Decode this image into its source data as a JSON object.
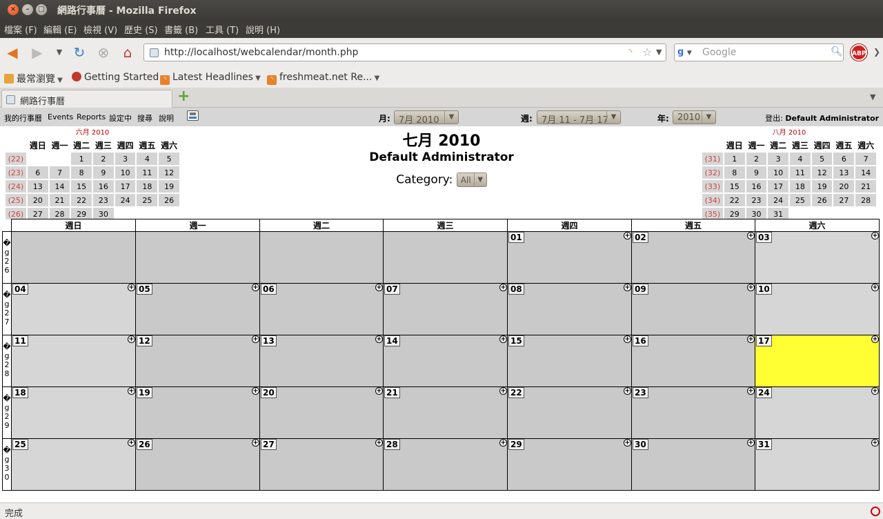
{
  "window": {
    "title": "網路行事曆 - Mozilla Firefox"
  },
  "menu": [
    "檔案 (F)",
    "編輯 (E)",
    "檢視 (V)",
    "歷史 (S)",
    "書籤 (B)",
    "工具 (T)",
    "說明 (H)"
  ],
  "nav": {
    "url": "http://localhost/webcalendar/month.php",
    "search_placeholder": "Google",
    "search_engine": "g",
    "abp_label": "ABP"
  },
  "bookmarks": [
    "最常瀏覽",
    "Getting Started",
    "Latest Headlines",
    "freshmeat.net Re..."
  ],
  "tab": {
    "title": "網路行事曆"
  },
  "app": {
    "links": [
      "我的行事曆",
      "Events",
      "Reports",
      "設定中",
      "搜尋",
      "說明"
    ],
    "month_label": "月:",
    "month_value": "7月 2010",
    "week_label": "週:",
    "week_value": "7月 11 - 7月 17",
    "year_label": "年:",
    "year_value": "2010",
    "logout_label": "登出:",
    "logout_user": "Default Administrator"
  },
  "header": {
    "month_title": "七月 2010",
    "user": "Default Administrator",
    "category_label": "Category:",
    "category_value": "All"
  },
  "weekday_short": [
    "週日",
    "週一",
    "週二",
    "週三",
    "週四",
    "週五",
    "週六"
  ],
  "mini_prev": {
    "title": "六月 2010",
    "weeks": [
      {
        "wk": "(22)",
        "days": [
          "",
          "",
          "1",
          "2",
          "3",
          "4",
          "5"
        ]
      },
      {
        "wk": "(23)",
        "days": [
          "6",
          "7",
          "8",
          "9",
          "10",
          "11",
          "12"
        ]
      },
      {
        "wk": "(24)",
        "days": [
          "13",
          "14",
          "15",
          "16",
          "17",
          "18",
          "19"
        ]
      },
      {
        "wk": "(25)",
        "days": [
          "20",
          "21",
          "22",
          "23",
          "24",
          "25",
          "26"
        ]
      },
      {
        "wk": "(26)",
        "days": [
          "27",
          "28",
          "29",
          "30",
          "",
          "",
          ""
        ]
      }
    ]
  },
  "mini_next": {
    "title": "八月 2010",
    "weeks": [
      {
        "wk": "(31)",
        "days": [
          "1",
          "2",
          "3",
          "4",
          "5",
          "6",
          "7"
        ]
      },
      {
        "wk": "(32)",
        "days": [
          "8",
          "9",
          "10",
          "11",
          "12",
          "13",
          "14"
        ]
      },
      {
        "wk": "(33)",
        "days": [
          "15",
          "16",
          "17",
          "18",
          "19",
          "20",
          "21"
        ]
      },
      {
        "wk": "(34)",
        "days": [
          "22",
          "23",
          "24",
          "25",
          "26",
          "27",
          "28"
        ]
      },
      {
        "wk": "(35)",
        "days": [
          "29",
          "30",
          "31",
          "",
          "",
          "",
          ""
        ]
      }
    ]
  },
  "month_grid": {
    "today": "17",
    "weeks": [
      {
        "wk": [
          "�",
          "g",
          "2",
          "6"
        ],
        "days": [
          "",
          "",
          "",
          "",
          "01",
          "02",
          "03"
        ]
      },
      {
        "wk": [
          "�",
          "g",
          "2",
          "7"
        ],
        "days": [
          "04",
          "05",
          "06",
          "07",
          "08",
          "09",
          "10"
        ]
      },
      {
        "wk": [
          "�",
          "g",
          "2",
          "8"
        ],
        "days": [
          "11",
          "12",
          "13",
          "14",
          "15",
          "16",
          "17"
        ]
      },
      {
        "wk": [
          "�",
          "g",
          "2",
          "9"
        ],
        "days": [
          "18",
          "19",
          "20",
          "21",
          "22",
          "23",
          "24"
        ]
      },
      {
        "wk": [
          "�",
          "g",
          "3",
          "0"
        ],
        "days": [
          "25",
          "26",
          "27",
          "28",
          "29",
          "30",
          "31"
        ]
      }
    ]
  },
  "status": {
    "text": "完成"
  },
  "colors": {
    "today": "#ffff33",
    "cell": "#c9c9c9",
    "weekend": "#d6d6d6",
    "week_number": "#cc4444",
    "mini_title": "#bb0000"
  }
}
